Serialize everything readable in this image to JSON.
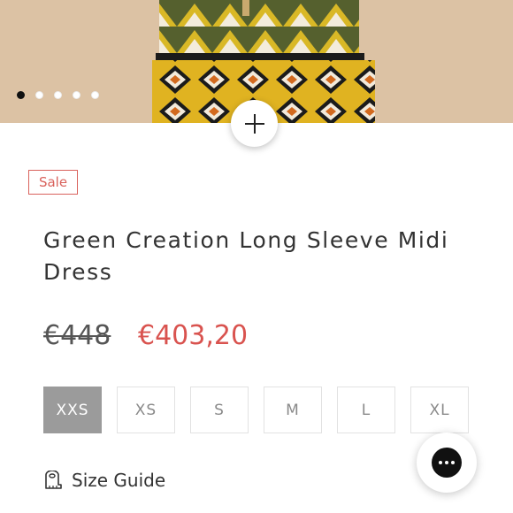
{
  "gallery": {
    "slide_count": 5,
    "active_index": 0,
    "zoom_icon": "plus-icon"
  },
  "product": {
    "badge": "Sale",
    "title": "Green Creation Long Sleeve Midi Dress",
    "original_price": "€448",
    "sale_price": "€403,20"
  },
  "sizes": {
    "options": [
      "XXS",
      "XS",
      "S",
      "M",
      "L",
      "XL"
    ],
    "selected": "XXS"
  },
  "size_guide": {
    "label": "Size Guide",
    "icon": "measuring-tape-icon"
  },
  "chat": {
    "icon": "chat-bubble-icon"
  },
  "colors": {
    "sale_red": "#d9534f",
    "selected_size_bg": "#9b9b9b",
    "text_dark": "#333333"
  }
}
